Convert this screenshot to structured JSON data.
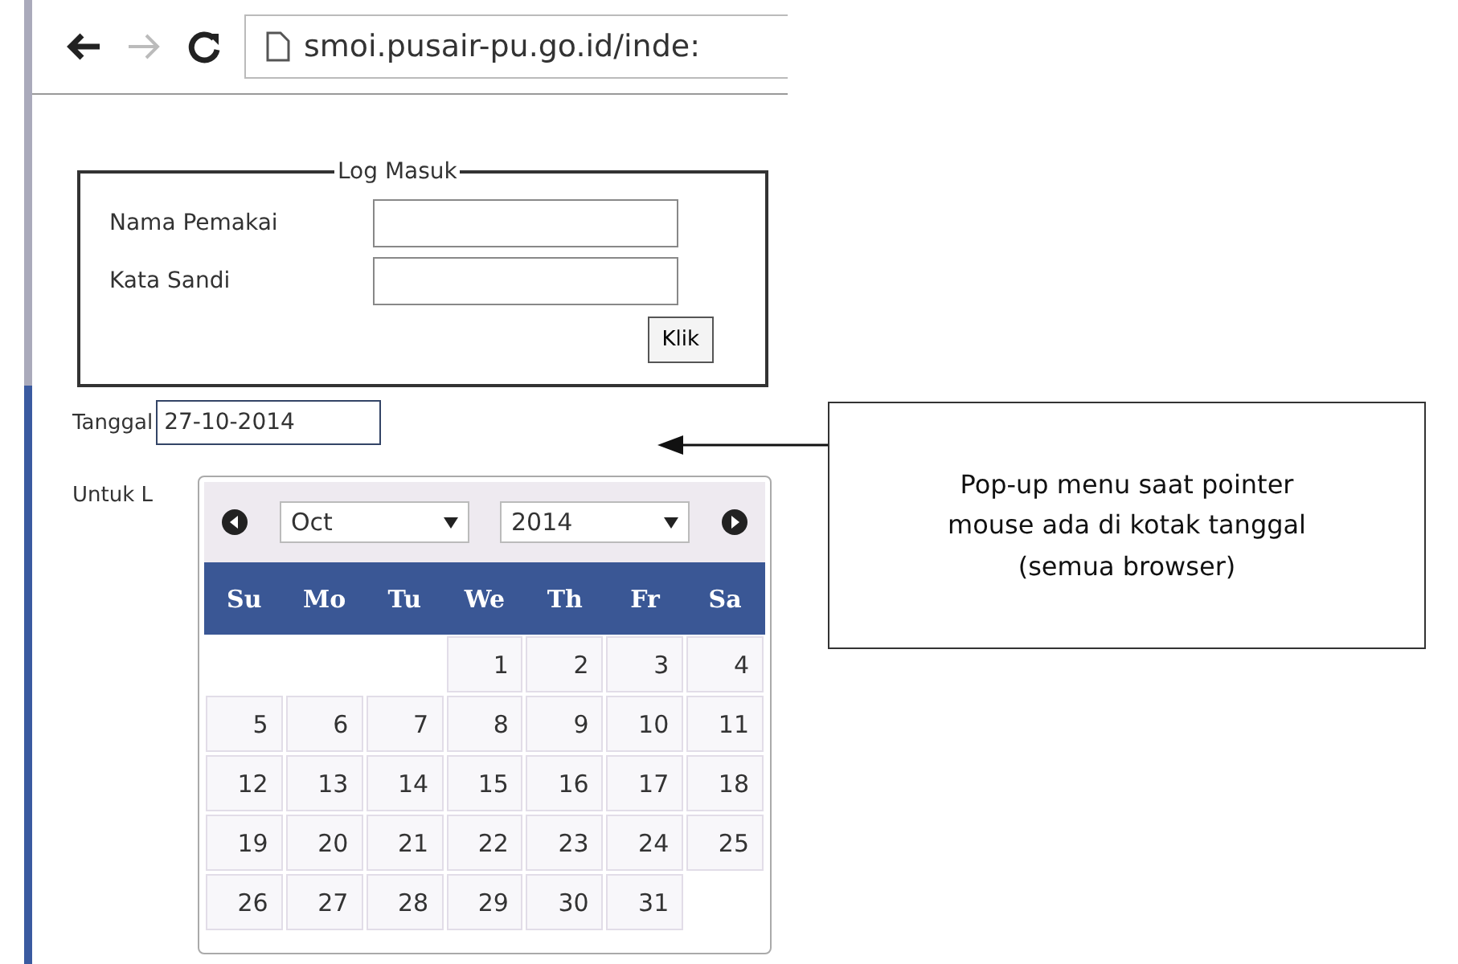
{
  "browser": {
    "url": "smoi.pusair-pu.go.id/inde:"
  },
  "login": {
    "legend": "Log Masuk",
    "fields": [
      {
        "label": "Nama Pemakai"
      },
      {
        "label": "Kata Sandi"
      }
    ],
    "button": "Klik"
  },
  "date_field": {
    "label": "Tanggal",
    "value": "27-10-2014"
  },
  "next_label": "Untuk L",
  "datepicker": {
    "month": "Oct",
    "year": "2014",
    "weekdays": [
      "Su",
      "Mo",
      "Tu",
      "We",
      "Th",
      "Fr",
      "Sa"
    ],
    "weeks": [
      {
        "kind": "first",
        "days": [
          "1",
          "2",
          "3",
          "4"
        ]
      },
      {
        "kind": "full",
        "days": [
          "5",
          "6",
          "7",
          "8",
          "9",
          "10",
          "11"
        ]
      },
      {
        "kind": "full",
        "days": [
          "12",
          "13",
          "14",
          "15",
          "16",
          "17",
          "18"
        ]
      },
      {
        "kind": "full",
        "days": [
          "19",
          "20",
          "21",
          "22",
          "23",
          "24",
          "25"
        ]
      },
      {
        "kind": "last",
        "days": [
          "26",
          "27",
          "28",
          "29",
          "30",
          "31"
        ]
      }
    ]
  },
  "callout": {
    "text": "Pop-up menu saat pointer mouse ada di kotak tanggal (semua browser)"
  }
}
